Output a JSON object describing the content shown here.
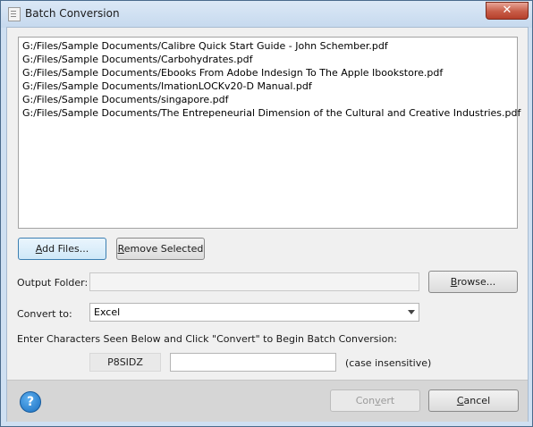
{
  "window": {
    "title": "Batch Conversion",
    "close_symbol": "✕"
  },
  "files": [
    "G:/Files/Sample Documents/Calibre Quick Start Guide - John Schember.pdf",
    "G:/Files/Sample Documents/Carbohydrates.pdf",
    "G:/Files/Sample Documents/Ebooks From Adobe Indesign To The Apple Ibookstore.pdf",
    "G:/Files/Sample Documents/ImationLOCKv20-D Manual.pdf",
    "G:/Files/Sample Documents/singapore.pdf",
    "G:/Files/Sample Documents/The Entrepeneurial Dimension of the Cultural and Creative Industries.pdf"
  ],
  "buttons": {
    "add_files_first": "A",
    "add_files_rest": "dd Files...",
    "remove_selected_first": "R",
    "remove_selected_rest": "emove Selected",
    "browse_first": "B",
    "browse_rest": "rowse...",
    "convert_pre": "Con",
    "convert_ul": "v",
    "convert_post": "ert",
    "cancel_first": "C",
    "cancel_rest": "ancel",
    "help_symbol": "?"
  },
  "output_folder": {
    "label": "Output Folder:",
    "value": ""
  },
  "convert_to": {
    "label": "Convert to:",
    "selected": "Excel"
  },
  "captcha": {
    "instruction": "Enter Characters Seen Below and Click \"Convert\" to Begin Batch Conversion:",
    "code": "P8SIDZ",
    "input_value": "",
    "note": "(case insensitive)"
  },
  "colors": {
    "titlebar": "#c6d9ee",
    "close": "#c75c47",
    "help": "#1a6fc0"
  }
}
